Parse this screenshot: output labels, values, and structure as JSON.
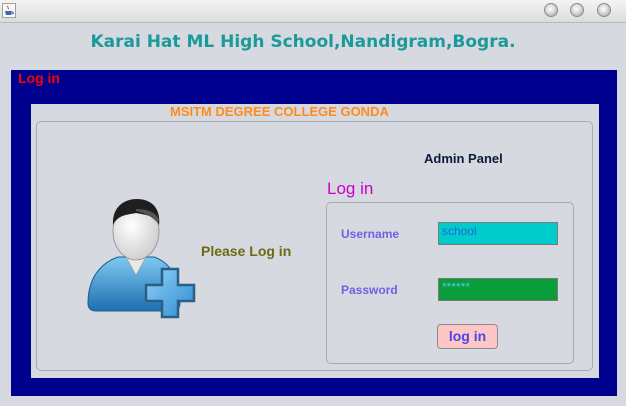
{
  "window": {
    "title_icon": "java-coffee-icon",
    "controls": [
      "minimize-icon",
      "zoom-icon",
      "close-icon"
    ]
  },
  "app_title": "Karai Hat ML High School,Nandigram,Bogra.",
  "panel": {
    "label": "Log in",
    "college_name": "MSITM DEGREE COLLEGE GONDA",
    "admin_label": "Admin Panel",
    "avatar_icon": "user-add-icon",
    "prompt": "Please Log in"
  },
  "login": {
    "heading": "Log in",
    "username_label": "Username",
    "username_value": "school",
    "password_label": "Password",
    "password_value": "******",
    "button_label": "log in"
  },
  "colors": {
    "title_teal": "#1a9a9a",
    "panel_blue": "#00008e",
    "label_red": "#ff0000",
    "college_orange": "#ff8a1e",
    "heading_magenta": "#cc00cc",
    "field_label_purple": "#6d62e6",
    "username_bg": "#00cccc",
    "password_bg": "#0a9e3a",
    "button_bg": "#ffc6c6"
  }
}
